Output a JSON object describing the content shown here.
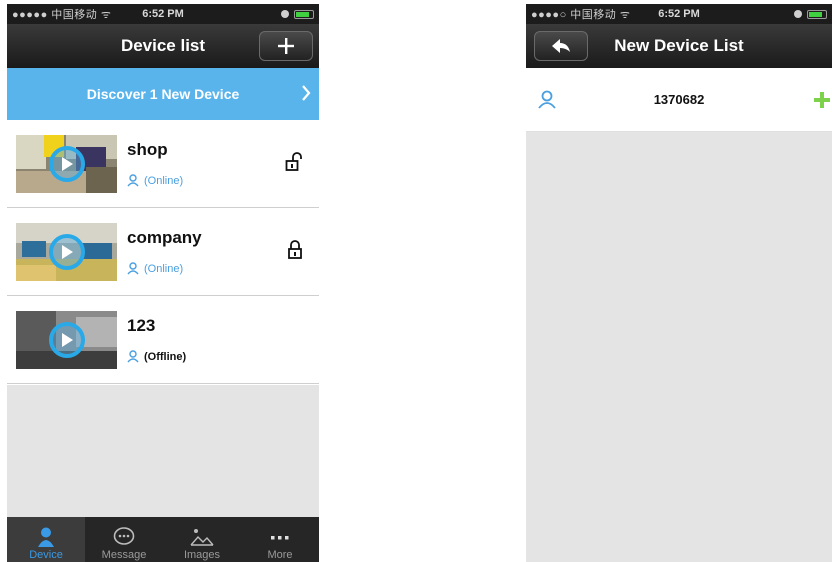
{
  "left_screen": {
    "status_bar": {
      "carrier": "●●●●● 中国移动 ᯤ",
      "time": "6:52 PM"
    },
    "nav": {
      "title": "Device list",
      "add_label": "+"
    },
    "discover_banner": {
      "text": "Discover 1 New Device"
    },
    "devices": [
      {
        "name": "shop",
        "status": "(Online)",
        "lock": "unlocked"
      },
      {
        "name": "company",
        "status": "(Online)",
        "lock": "locked"
      },
      {
        "name": "123",
        "status": "(Offline)",
        "lock": "none"
      }
    ],
    "tabs": [
      {
        "label": "Device",
        "icon": "person-icon",
        "active": true
      },
      {
        "label": "Message",
        "icon": "chat-bubble-icon",
        "active": false
      },
      {
        "label": "Images",
        "icon": "image-icon",
        "active": false
      },
      {
        "label": "More",
        "icon": "more-dots-icon",
        "active": false
      }
    ]
  },
  "right_screen": {
    "status_bar": {
      "carrier": "●●●●○ 中国移动 ᯤ",
      "time": "6:52 PM"
    },
    "nav": {
      "title": "New Device List"
    },
    "new_devices": [
      {
        "id": "1370682"
      }
    ]
  },
  "colors": {
    "accent_blue": "#5ab4ec",
    "tab_active": "#3a9ae6",
    "add_green": "#7ed14a"
  }
}
